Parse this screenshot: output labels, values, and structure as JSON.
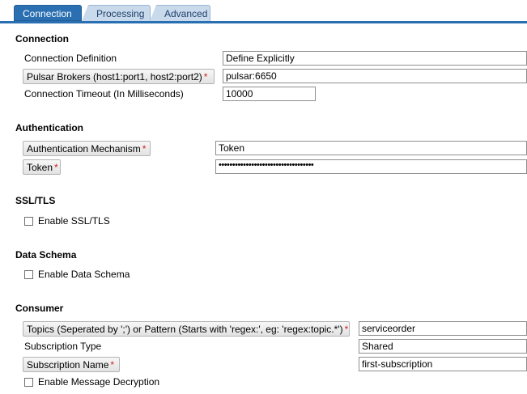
{
  "tabs": [
    {
      "label": "Connection",
      "active": true
    },
    {
      "label": "Processing",
      "active": false
    },
    {
      "label": "Advanced",
      "active": false
    }
  ],
  "connection": {
    "title": "Connection",
    "definition_label": "Connection Definition",
    "definition_value": "Define Explicitly",
    "brokers_label": "Pulsar Brokers (host1:port1, host2:port2)",
    "brokers_value": "pulsar:6650",
    "timeout_label": "Connection Timeout (In Milliseconds)",
    "timeout_value": "10000"
  },
  "authentication": {
    "title": "Authentication",
    "mechanism_label": "Authentication Mechanism",
    "mechanism_value": "Token",
    "token_label": "Token",
    "token_value": "•••••••••••••••••••••••••••••••••••"
  },
  "ssl": {
    "title": "SSL/TLS",
    "enable_label": "Enable SSL/TLS"
  },
  "schema": {
    "title": "Data Schema",
    "enable_label": "Enable Data Schema"
  },
  "consumer": {
    "title": "Consumer",
    "topics_label": "Topics (Seperated by ';') or Pattern (Starts with 'regex:', eg: 'regex:topic.*')",
    "topics_value": "serviceorder",
    "sub_type_label": "Subscription Type",
    "sub_type_value": "Shared",
    "sub_name_label": "Subscription Name",
    "sub_name_value": "first-subscription",
    "decrypt_label": "Enable Message Decryption"
  },
  "required_marker": "*",
  "colors": {
    "tab_active": "#2a6fb1",
    "tab_inactive": "#c9daec",
    "required": "#d42020"
  }
}
